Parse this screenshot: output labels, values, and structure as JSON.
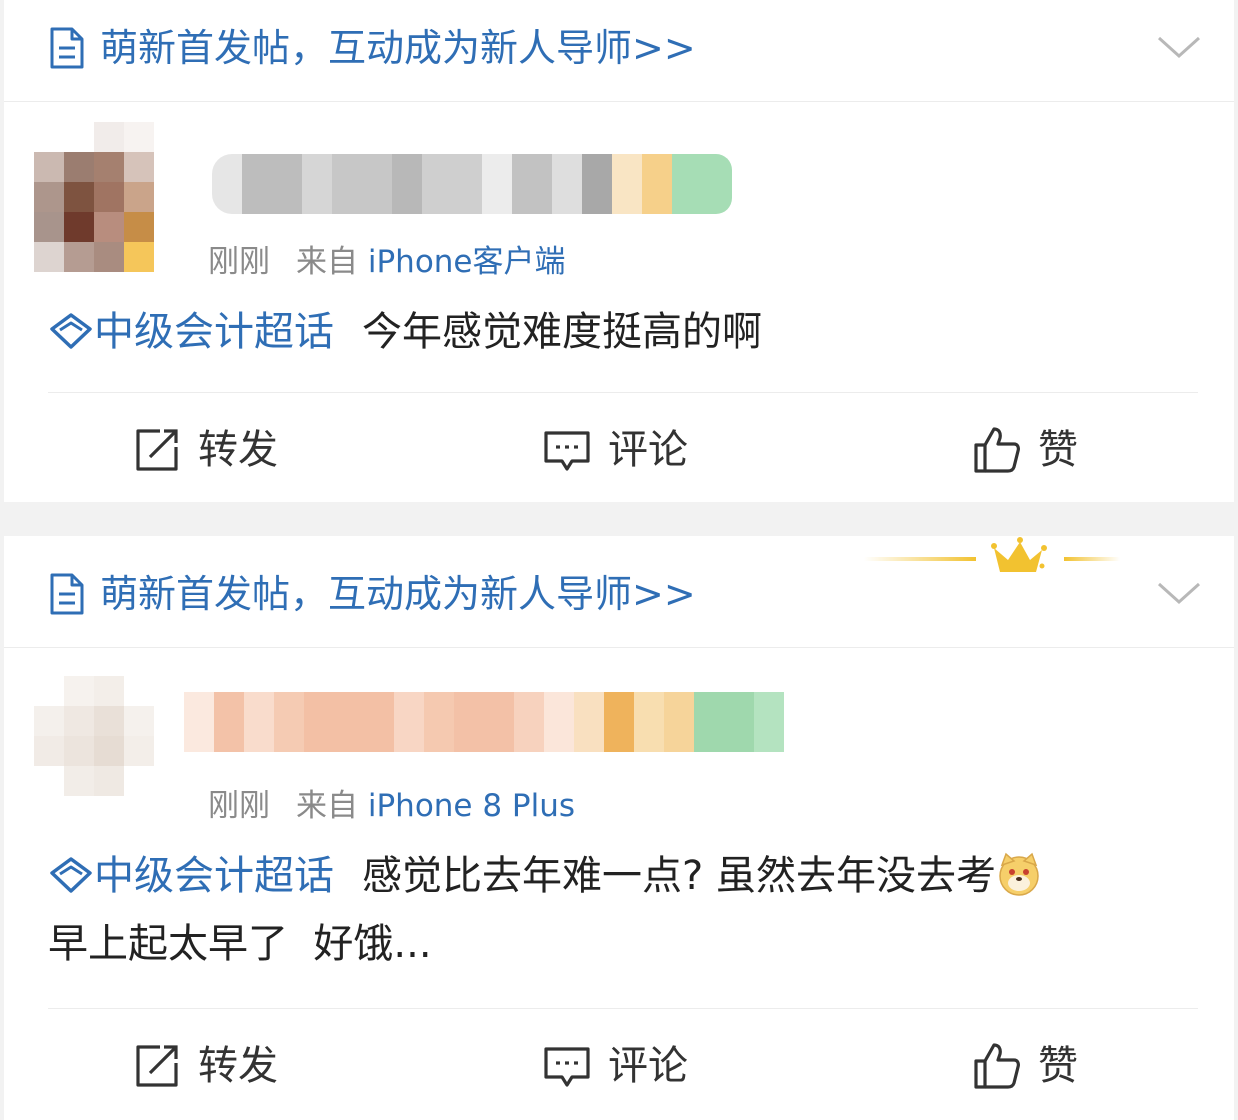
{
  "posts": [
    {
      "banner_text": "萌新首发帖，互动成为新人导师>>",
      "time": "刚刚",
      "from_label": "来自",
      "source": "iPhone客户端",
      "topic": "中级会计超话",
      "content": "今年感觉难度挺高的啊",
      "content_line2": "",
      "actions": {
        "repost": "转发",
        "comment": "评论",
        "like": "赞"
      }
    },
    {
      "banner_text": "萌新首发帖，互动成为新人导师>>",
      "time": "刚刚",
      "from_label": "来自",
      "source": "iPhone 8 Plus",
      "topic": "中级会计超话",
      "content": "感觉比去年难一点? 虽然去年没去考",
      "content_line2": "早上起太早了  好饿...",
      "actions": {
        "repost": "转发",
        "comment": "评论",
        "like": "赞"
      }
    }
  ],
  "colors": {
    "link_blue": "#2f6eb5",
    "meta_gray": "#8a8a8a",
    "page_bg": "#f2f2f2",
    "crown_gold": "#f2c230"
  },
  "icons": {
    "banner": "document-icon",
    "collapse": "chevron-down-icon",
    "topic": "diamond-icon",
    "repost": "share-icon",
    "comment": "comment-icon",
    "like": "thumbs-up-icon",
    "emoji": "doge-emoji-icon",
    "decoration": "crown-icon"
  }
}
